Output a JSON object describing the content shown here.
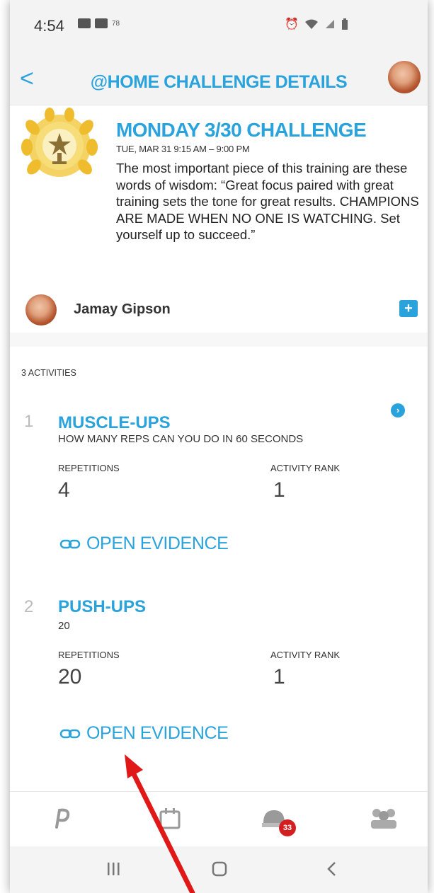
{
  "status_bar": {
    "time": "4:54",
    "notif": "78"
  },
  "header": {
    "back_label": "<",
    "title": "@HOME CHALLENGE DETAILS"
  },
  "challenge": {
    "title": "MONDAY 3/30 CHALLENGE",
    "datetime": "TUE, MAR 31 9:15 AM – 9:00 PM",
    "description": "The most important piece of this training are these words of wisdom: “Great focus paired with great training sets the tone for great results. CHAMPIONS ARE MADE WHEN NO ONE IS WATCHING. Set yourself up to succeed.”"
  },
  "user": {
    "name": "Jamay Gipson",
    "comment_label": "+"
  },
  "activities_count": "3 ACTIVITIES",
  "activities": [
    {
      "number": "1",
      "title": "MUSCLE-UPS",
      "subtitle": "HOW MANY REPS CAN YOU DO IN 60 SECONDS",
      "stat1_label": "REPETITIONS",
      "stat1_value": "4",
      "stat2_label": "ACTIVITY RANK",
      "stat2_value": "1",
      "evidence_label": "OPEN EVIDENCE"
    },
    {
      "number": "2",
      "title": "PUSH-UPS",
      "subtitle": "20",
      "stat1_label": "REPETITIONS",
      "stat1_value": "20",
      "stat2_label": "ACTIVITY RANK",
      "stat2_value": "1",
      "evidence_label": "OPEN EVIDENCE"
    }
  ],
  "bottom_nav": {
    "badge": "33"
  },
  "colors": {
    "accent": "#2aa3dc",
    "badge": "#d22020",
    "annotation": "#e01818"
  }
}
